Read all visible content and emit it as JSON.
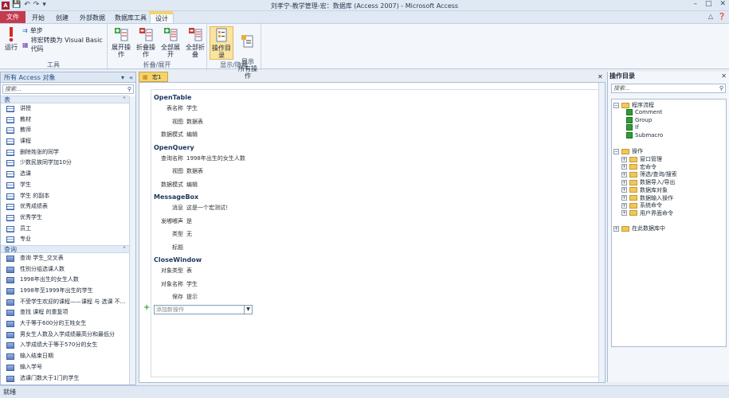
{
  "window": {
    "title": "刘孝宁-教学管理-宏：数据库 (Access 2007)  -  Microsoft Access",
    "app_icon": "A",
    "qat": [
      "save-icon",
      "undo-icon",
      "redo-icon",
      "customize-icon"
    ],
    "controls": [
      "–",
      "□",
      "✕"
    ]
  },
  "ribbon_tabs": {
    "file": "文件",
    "tabs": [
      "开始",
      "创建",
      "外部数据",
      "数据库工具",
      "设计"
    ],
    "contextual": "宏工具"
  },
  "ribbon": {
    "tools": {
      "label": "工具",
      "run": "运行",
      "single_step": "单步",
      "convert": "将宏转换为 Visual Basic 代码"
    },
    "collapse": {
      "label": "折叠/展开",
      "expand_actions": "展开操作",
      "collapse_actions": "折叠操作",
      "expand_all": "全部展开",
      "collapse_all": "全部折叠"
    },
    "show_hide": {
      "label": "显示/隐藏",
      "action_catalog": "操作目录",
      "show_all_actions": "显示\n所有操作"
    }
  },
  "nav_pane": {
    "title": "所有 Access 对象",
    "search_placeholder": "搜索...",
    "tables_header": "表",
    "tables": [
      "讲授",
      "教材",
      "教师",
      "课程",
      "删除姓张的同学",
      "少数民族同学加10分",
      "选课",
      "学生",
      "学生 的副本",
      "优秀成绩表",
      "优秀学生",
      "员工",
      "专业"
    ],
    "queries_header": "查询",
    "queries": [
      "查询 学生_交叉表",
      "性别分组选课人数",
      "1998年出生的女生人数",
      "1998年至1999年出生的学生",
      "不受学生欢迎的课程——课程 与 选课 不...",
      "查找 课程 的重复项",
      "大于等于600分的王姓女生",
      "男女生人数及入学成绩最高分和最低分",
      "入学成绩大于等于570分的女生",
      "输入结束日期",
      "输入学号",
      "选课门数大于1门的学生"
    ]
  },
  "document": {
    "tab_label": "宏1",
    "actions": [
      {
        "name": "OpenTable",
        "args": [
          [
            "表名称",
            "学生"
          ],
          [
            "视图",
            "数据表"
          ],
          [
            "数据模式",
            "编辑"
          ]
        ]
      },
      {
        "name": "OpenQuery",
        "args": [
          [
            "查询名称",
            "1998年出生的女生人数"
          ],
          [
            "视图",
            "数据表"
          ],
          [
            "数据模式",
            "编辑"
          ]
        ]
      },
      {
        "name": "MessageBox",
        "args": [
          [
            "消息",
            "这是一个宏测试！"
          ],
          [
            "发嘟嘟声",
            "是"
          ],
          [
            "类型",
            "无"
          ],
          [
            "标题",
            ""
          ]
        ]
      },
      {
        "name": "CloseWindow",
        "args": [
          [
            "对象类型",
            "表"
          ],
          [
            "对象名称",
            "学生"
          ],
          [
            "保存",
            "提示"
          ]
        ]
      }
    ],
    "add_action_placeholder": "添加新操作"
  },
  "catalog": {
    "title": "操作目录",
    "search_placeholder": "搜索...",
    "program_flow": "程序流程",
    "flow_items": [
      "Comment",
      "Group",
      "If",
      "Submacro"
    ],
    "actions": "操作",
    "action_groups": [
      "窗口管理",
      "宏命令",
      "筛选/查询/搜索",
      "数据导入/导出",
      "数据库对象",
      "数据输入操作",
      "系统命令",
      "用户界面命令"
    ],
    "in_this_db": "在此数据库中"
  },
  "status": {
    "text": "就绪"
  }
}
